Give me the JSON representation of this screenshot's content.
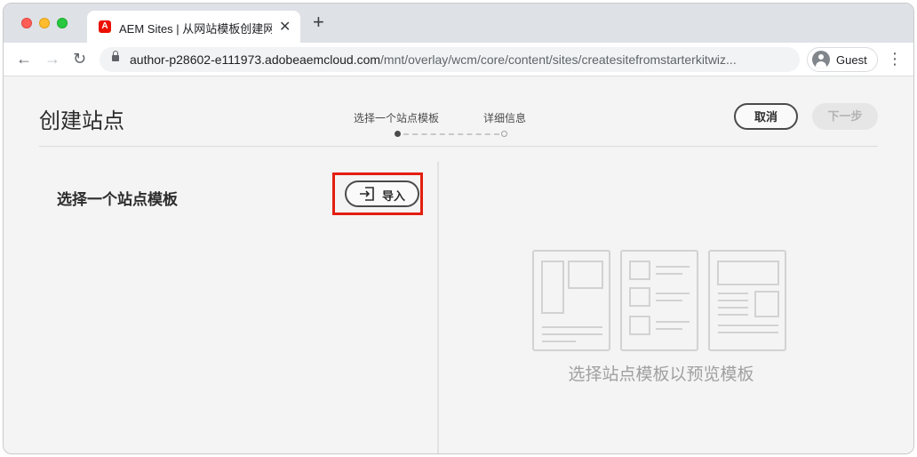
{
  "browser": {
    "tab_title": "AEM Sites | 从网站模板创建网站",
    "tab_favicon_text": "A",
    "tab_close": "✕",
    "new_tab": "+",
    "url_host": "author-p28602-e111973.adobeaemcloud.com",
    "url_path": "/mnt/overlay/wcm/core/content/sites/createsitefromstarterkitwiz...",
    "profile_label": "Guest",
    "back": "←",
    "forward": "→",
    "reload": "↻",
    "menu": "⋮"
  },
  "page": {
    "title": "创建站点",
    "steps": [
      {
        "label": "选择一个站点模板",
        "active": true
      },
      {
        "label": "详细信息",
        "active": false
      }
    ],
    "cancel_label": "取消",
    "next_label": "下一步"
  },
  "left_panel": {
    "heading": "选择一个站点模板",
    "import_label": "导入",
    "highlight_color": "#e31e10"
  },
  "right_panel": {
    "placeholder_text": "选择站点模板以预览模板"
  },
  "icons": {
    "tab_favicon": "adobe-icon",
    "lock": "lock-icon",
    "avatar": "avatar-icon",
    "import": "import-icon",
    "preview": "template-preview-illustration"
  }
}
